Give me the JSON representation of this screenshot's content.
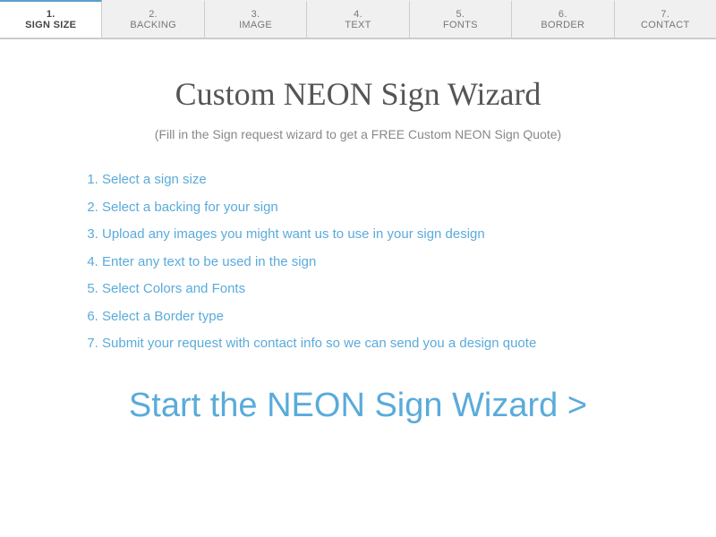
{
  "tabs": [
    {
      "id": "sign-size",
      "label": "SIGN SIZE",
      "number": "1.",
      "active": true
    },
    {
      "id": "backing",
      "label": "BACKING",
      "number": "2.",
      "active": false
    },
    {
      "id": "image",
      "label": "IMAGE",
      "number": "3.",
      "active": false
    },
    {
      "id": "text",
      "label": "TEXT",
      "number": "4.",
      "active": false
    },
    {
      "id": "fonts",
      "label": "FONTS",
      "number": "5.",
      "active": false
    },
    {
      "id": "border",
      "label": "BORDER",
      "number": "6.",
      "active": false
    },
    {
      "id": "contact",
      "label": "CONTACT",
      "number": "7.",
      "active": false
    }
  ],
  "page": {
    "title": "Custom NEON Sign Wizard",
    "subtitle": "(Fill in the Sign request wizard to get a FREE Custom NEON Sign Quote)",
    "steps": [
      "Select a sign size",
      "Select a backing for your sign",
      "Upload any images you might want us to use in your sign design",
      "Enter any text to be used in the sign",
      "Select Colors and Fonts",
      "Select a Border type",
      "Submit your request with contact info so we can send you a design quote"
    ],
    "cta_label": "Start the NEON Sign Wizard >"
  }
}
